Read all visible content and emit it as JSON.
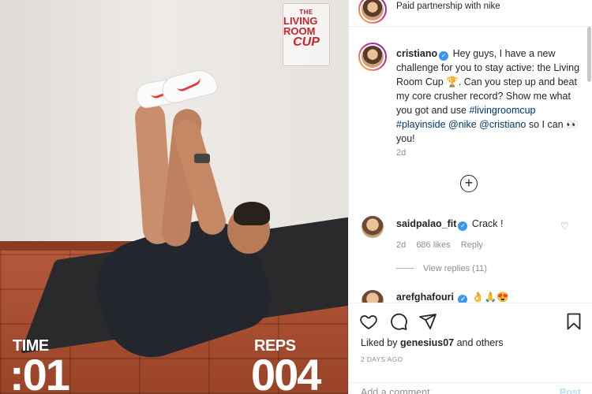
{
  "media": {
    "logo": {
      "line1": "THE",
      "line2": "LIVING ROOM",
      "line3": "CUP"
    },
    "time_label": "TIME",
    "time_value": ":01",
    "reps_label": "REPS",
    "reps_value": "004"
  },
  "header": {
    "partner_text": "Paid partnership with nike"
  },
  "caption": {
    "username": "cristiano",
    "text_part1": " Hey guys, I have a new challenge for you to stay active: the Living Room Cup ",
    "trophy": "🏆",
    "text_part2": ". Can you step up and beat my core crusher record? Show me what you got and use ",
    "hashtag1": "#livingroomcup",
    "hashtag2": "#playinside",
    "mention1": "@nike",
    "mention2": "@cristiano",
    "text_part3": " so I can ",
    "eyes": "👀",
    "text_part4": " you!",
    "time": "2d"
  },
  "comments": [
    {
      "username": "saidpalao_fit",
      "text": "Crack !",
      "time": "2d",
      "likes": "686 likes",
      "reply": "Reply",
      "view_replies": "View replies (11)"
    }
  ],
  "partial_comment": {
    "username": "arefghafouri",
    "emoji": "👌🙏😍"
  },
  "actions": {
    "liked_by_prefix": "Liked by ",
    "liked_by_user": "genesius07",
    "liked_by_suffix": " and others",
    "timeago": "2 DAYS AGO",
    "comment_placeholder": "Add a comment…",
    "post_label": "Post"
  },
  "icons": [
    "more-icon",
    "verified-icon",
    "add-comment-icon",
    "heart-icon",
    "comment-icon",
    "share-icon",
    "bookmark-icon"
  ]
}
